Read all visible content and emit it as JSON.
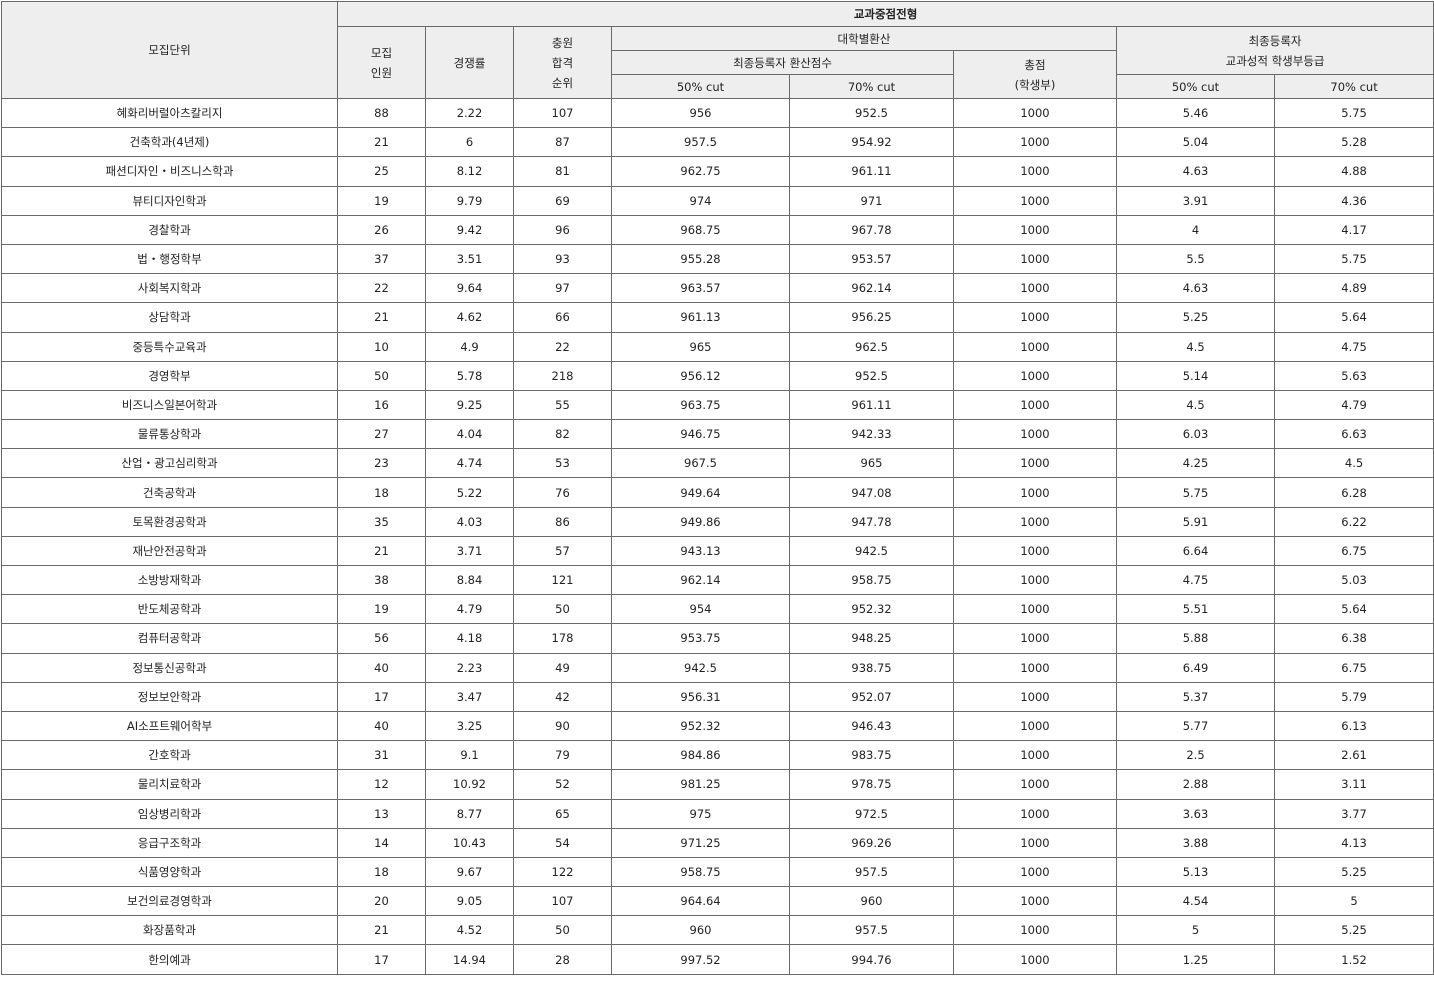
{
  "header": {
    "title": "교과중점전형",
    "col_unit": "모집단위",
    "col_quota": [
      "모집",
      "인원"
    ],
    "col_ratio": "경쟁률",
    "col_rank": [
      "충원",
      "합격",
      "순위"
    ],
    "group_univ": "대학별환산",
    "sub_score": "최종등록자 환산점수",
    "cut50": "50% cut",
    "cut70": "70% cut",
    "col_total": [
      "총점",
      "(학생부)"
    ],
    "group_grade": [
      "최종등록자",
      "교과성적 학생부등급"
    ],
    "grade50": "50% cut",
    "grade70": "70% cut"
  },
  "rows": [
    {
      "unit": "혜화리버럴아츠칼리지",
      "quota": "88",
      "ratio": "2.22",
      "rank": "107",
      "s50": "956",
      "s70": "952.5",
      "total": "1000",
      "g50": "5.46",
      "g70": "5.75"
    },
    {
      "unit": "건축학과(4년제)",
      "quota": "21",
      "ratio": "6",
      "rank": "87",
      "s50": "957.5",
      "s70": "954.92",
      "total": "1000",
      "g50": "5.04",
      "g70": "5.28"
    },
    {
      "unit": "패션디자인・비즈니스학과",
      "quota": "25",
      "ratio": "8.12",
      "rank": "81",
      "s50": "962.75",
      "s70": "961.11",
      "total": "1000",
      "g50": "4.63",
      "g70": "4.88"
    },
    {
      "unit": "뷰티디자인학과",
      "quota": "19",
      "ratio": "9.79",
      "rank": "69",
      "s50": "974",
      "s70": "971",
      "total": "1000",
      "g50": "3.91",
      "g70": "4.36"
    },
    {
      "unit": "경찰학과",
      "quota": "26",
      "ratio": "9.42",
      "rank": "96",
      "s50": "968.75",
      "s70": "967.78",
      "total": "1000",
      "g50": "4",
      "g70": "4.17"
    },
    {
      "unit": "법・행정학부",
      "quota": "37",
      "ratio": "3.51",
      "rank": "93",
      "s50": "955.28",
      "s70": "953.57",
      "total": "1000",
      "g50": "5.5",
      "g70": "5.75"
    },
    {
      "unit": "사회복지학과",
      "quota": "22",
      "ratio": "9.64",
      "rank": "97",
      "s50": "963.57",
      "s70": "962.14",
      "total": "1000",
      "g50": "4.63",
      "g70": "4.89"
    },
    {
      "unit": "상담학과",
      "quota": "21",
      "ratio": "4.62",
      "rank": "66",
      "s50": "961.13",
      "s70": "956.25",
      "total": "1000",
      "g50": "5.25",
      "g70": "5.64"
    },
    {
      "unit": "중등특수교육과",
      "quota": "10",
      "ratio": "4.9",
      "rank": "22",
      "s50": "965",
      "s70": "962.5",
      "total": "1000",
      "g50": "4.5",
      "g70": "4.75"
    },
    {
      "unit": "경영학부",
      "quota": "50",
      "ratio": "5.78",
      "rank": "218",
      "s50": "956.12",
      "s70": "952.5",
      "total": "1000",
      "g50": "5.14",
      "g70": "5.63"
    },
    {
      "unit": "비즈니스일본어학과",
      "quota": "16",
      "ratio": "9.25",
      "rank": "55",
      "s50": "963.75",
      "s70": "961.11",
      "total": "1000",
      "g50": "4.5",
      "g70": "4.79"
    },
    {
      "unit": "물류통상학과",
      "quota": "27",
      "ratio": "4.04",
      "rank": "82",
      "s50": "946.75",
      "s70": "942.33",
      "total": "1000",
      "g50": "6.03",
      "g70": "6.63"
    },
    {
      "unit": "산업・광고심리학과",
      "quota": "23",
      "ratio": "4.74",
      "rank": "53",
      "s50": "967.5",
      "s70": "965",
      "total": "1000",
      "g50": "4.25",
      "g70": "4.5"
    },
    {
      "unit": "건축공학과",
      "quota": "18",
      "ratio": "5.22",
      "rank": "76",
      "s50": "949.64",
      "s70": "947.08",
      "total": "1000",
      "g50": "5.75",
      "g70": "6.28"
    },
    {
      "unit": "토목환경공학과",
      "quota": "35",
      "ratio": "4.03",
      "rank": "86",
      "s50": "949.86",
      "s70": "947.78",
      "total": "1000",
      "g50": "5.91",
      "g70": "6.22"
    },
    {
      "unit": "재난안전공학과",
      "quota": "21",
      "ratio": "3.71",
      "rank": "57",
      "s50": "943.13",
      "s70": "942.5",
      "total": "1000",
      "g50": "6.64",
      "g70": "6.75"
    },
    {
      "unit": "소방방재학과",
      "quota": "38",
      "ratio": "8.84",
      "rank": "121",
      "s50": "962.14",
      "s70": "958.75",
      "total": "1000",
      "g50": "4.75",
      "g70": "5.03"
    },
    {
      "unit": "반도체공학과",
      "quota": "19",
      "ratio": "4.79",
      "rank": "50",
      "s50": "954",
      "s70": "952.32",
      "total": "1000",
      "g50": "5.51",
      "g70": "5.64"
    },
    {
      "unit": "컴퓨터공학과",
      "quota": "56",
      "ratio": "4.18",
      "rank": "178",
      "s50": "953.75",
      "s70": "948.25",
      "total": "1000",
      "g50": "5.88",
      "g70": "6.38"
    },
    {
      "unit": "정보통신공학과",
      "quota": "40",
      "ratio": "2.23",
      "rank": "49",
      "s50": "942.5",
      "s70": "938.75",
      "total": "1000",
      "g50": "6.49",
      "g70": "6.75"
    },
    {
      "unit": "정보보안학과",
      "quota": "17",
      "ratio": "3.47",
      "rank": "42",
      "s50": "956.31",
      "s70": "952.07",
      "total": "1000",
      "g50": "5.37",
      "g70": "5.79"
    },
    {
      "unit": "AI소프트웨어학부",
      "quota": "40",
      "ratio": "3.25",
      "rank": "90",
      "s50": "952.32",
      "s70": "946.43",
      "total": "1000",
      "g50": "5.77",
      "g70": "6.13"
    },
    {
      "unit": "간호학과",
      "quota": "31",
      "ratio": "9.1",
      "rank": "79",
      "s50": "984.86",
      "s70": "983.75",
      "total": "1000",
      "g50": "2.5",
      "g70": "2.61"
    },
    {
      "unit": "물리치료학과",
      "quota": "12",
      "ratio": "10.92",
      "rank": "52",
      "s50": "981.25",
      "s70": "978.75",
      "total": "1000",
      "g50": "2.88",
      "g70": "3.11"
    },
    {
      "unit": "임상병리학과",
      "quota": "13",
      "ratio": "8.77",
      "rank": "65",
      "s50": "975",
      "s70": "972.5",
      "total": "1000",
      "g50": "3.63",
      "g70": "3.77"
    },
    {
      "unit": "응급구조학과",
      "quota": "14",
      "ratio": "10.43",
      "rank": "54",
      "s50": "971.25",
      "s70": "969.26",
      "total": "1000",
      "g50": "3.88",
      "g70": "4.13"
    },
    {
      "unit": "식품영양학과",
      "quota": "18",
      "ratio": "9.67",
      "rank": "122",
      "s50": "958.75",
      "s70": "957.5",
      "total": "1000",
      "g50": "5.13",
      "g70": "5.25"
    },
    {
      "unit": "보건의료경영학과",
      "quota": "20",
      "ratio": "9.05",
      "rank": "107",
      "s50": "964.64",
      "s70": "960",
      "total": "1000",
      "g50": "4.54",
      "g70": "5"
    },
    {
      "unit": "화장품학과",
      "quota": "21",
      "ratio": "4.52",
      "rank": "50",
      "s50": "960",
      "s70": "957.5",
      "total": "1000",
      "g50": "5",
      "g70": "5.25"
    },
    {
      "unit": "한의예과",
      "quota": "17",
      "ratio": "14.94",
      "rank": "28",
      "s50": "997.52",
      "s70": "994.76",
      "total": "1000",
      "g50": "1.25",
      "g70": "1.52"
    }
  ]
}
